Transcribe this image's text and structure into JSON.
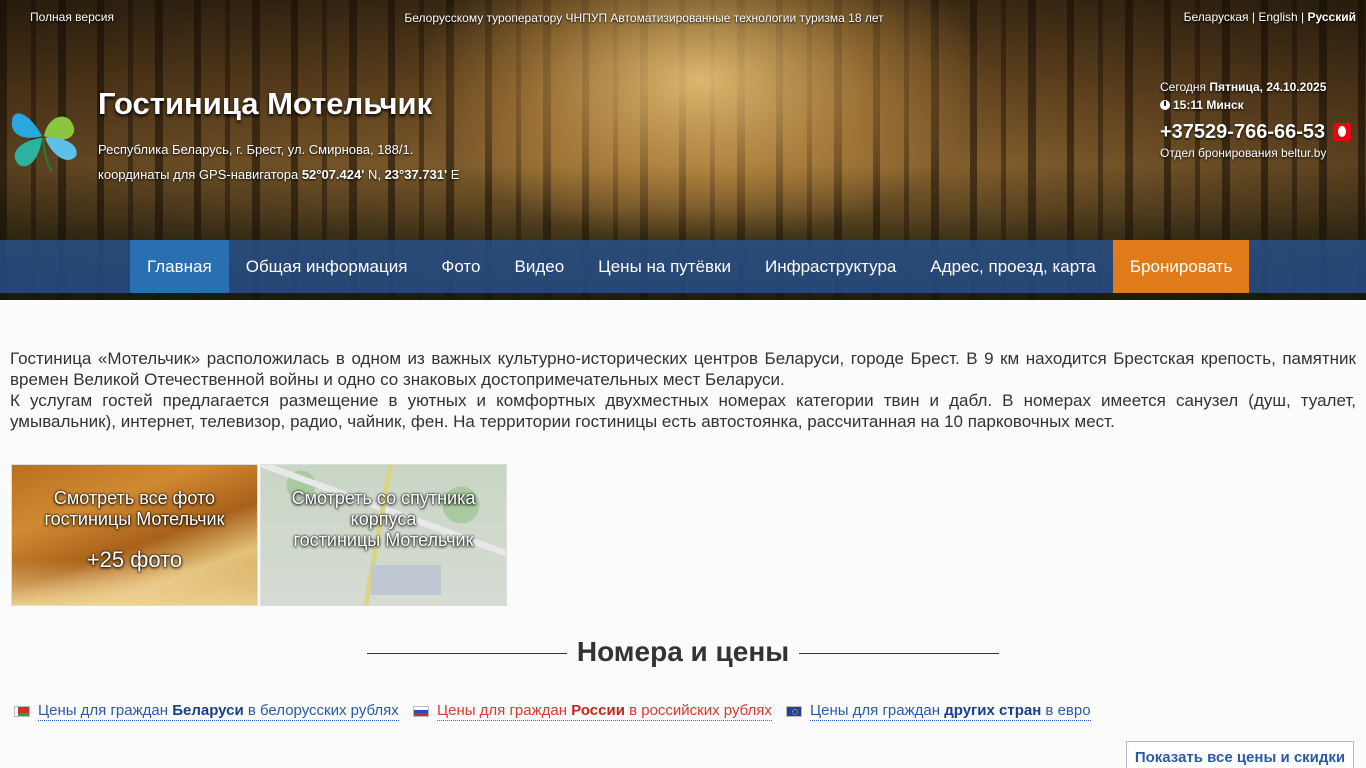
{
  "header": {
    "full_version": "Полная версия",
    "tagline": "Белорусскому туроператору ЧНПУП Автоматизированные технологии туризма 18 лет",
    "languages": {
      "be": "Беларуская",
      "en": "English",
      "ru": "Русский",
      "separator": " | "
    },
    "title": "Гостиница Мотельчик",
    "address": "Республика Беларусь, г. Брест, ул. Смирнова, 188/1.",
    "coords": {
      "prefix": "координаты для GPS-навигатора ",
      "lat": "52°07.424'",
      "lat_suffix": " N, ",
      "lon": "23°37.731'",
      "lon_suffix": " E"
    },
    "info": {
      "today_label": "Сегодня ",
      "today_value": "Пятница, 24.10.2025",
      "time": "15:11 Минск",
      "phone": "+37529-766-66-53",
      "booking": "Отдел бронирования beltur.by"
    }
  },
  "nav": {
    "items": [
      "Главная",
      "Общая информация",
      "Фото",
      "Видео",
      "Цены на путёвки",
      "Инфраструктура",
      "Адрес, проезд, карта",
      "Бронировать"
    ]
  },
  "intro": {
    "p1": "Гостиница «Мотельчик» расположилась в одном из важных культурно-исторических центров Беларуси, городе Брест. В 9 км находится Брестская крепость, памятник времен Великой Отечественной войны и одно со знаковых достопримечательных мест Беларуси.",
    "p2": "К услугам гостей предлагается размещение в уютных и комфортных двухместных номерах категории твин и дабл. В номерах имеется санузел (душ, туалет, умывальник), интернет, телевизор, радио, чайник, фен. На территории гостиницы есть автостоянка, рассчитанная на 10 парковочных мест."
  },
  "tiles": {
    "photos_line1": "Смотреть все фото",
    "photos_line2": "гостиницы Мотельчик",
    "photos_count": "+25 фото",
    "satellite_line1": "Смотреть со спутника",
    "satellite_line2": "корпуса",
    "satellite_line3": "гостиницы Мотельчик"
  },
  "prices": {
    "section_title": "Номера и цены",
    "by": {
      "pre": "Цены для граждан ",
      "bold": "Беларуси",
      "post": " в белорусских рублях"
    },
    "ru": {
      "pre": "Цены для граждан ",
      "bold": "России",
      "post": " в российских рублях"
    },
    "other": {
      "pre": "Цены для граждан ",
      "bold": "других стран",
      "post": " в евро"
    },
    "show_all": "Показать все цены и скидки"
  },
  "colors": {
    "nav_bg": "#2f5a94",
    "nav_active": "#2a6fb0",
    "book_button": "#e07b1a",
    "link_blue": "#2b5aa8",
    "link_red": "#d83a2e"
  }
}
